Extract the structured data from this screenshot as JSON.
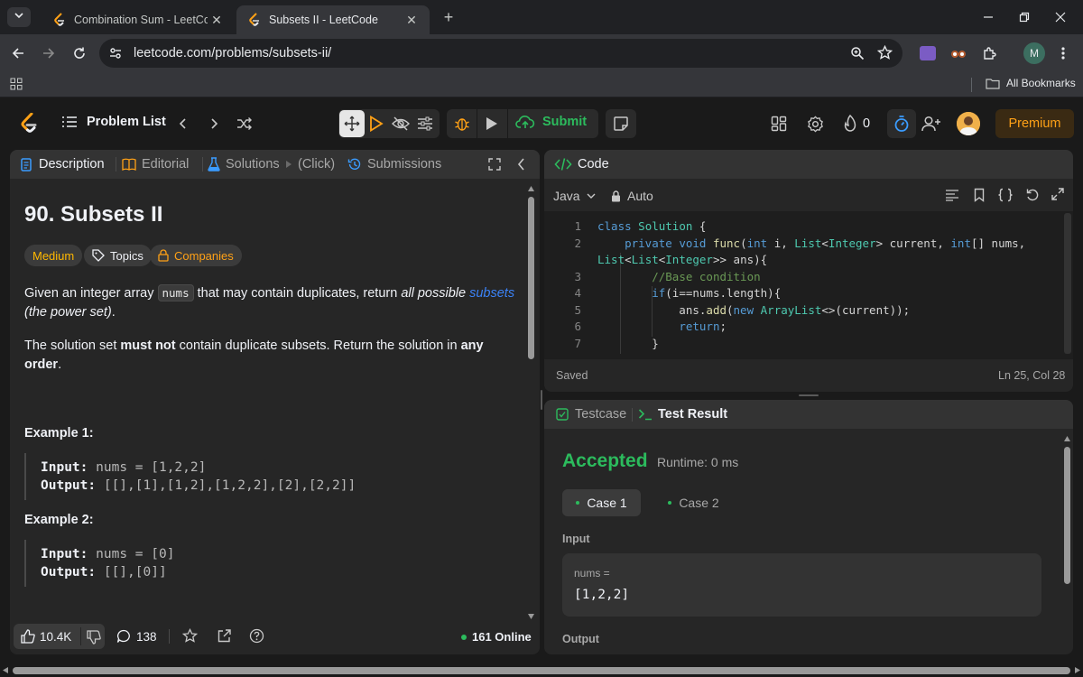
{
  "browser": {
    "tabs": [
      {
        "title": "Combination Sum - LeetCode",
        "active": false
      },
      {
        "title": "Subsets II - LeetCode",
        "active": true
      }
    ],
    "url": "leetcode.com/problems/subsets-ii/",
    "bookmarks_label": "All Bookmarks",
    "profile_initial": "M"
  },
  "toolbar": {
    "problem_list": "Problem List",
    "submit": "Submit",
    "streak": "0",
    "premium": "Premium"
  },
  "left_tabs": {
    "description": "Description",
    "editorial": "Editorial",
    "solutions": "Solutions",
    "click": "(Click)",
    "submissions": "Submissions"
  },
  "problem": {
    "title": "90. Subsets II",
    "difficulty": "Medium",
    "topics": "Topics",
    "companies": "Companies",
    "desc1_a": "Given an integer array ",
    "desc1_code": "nums",
    "desc1_b": " that may contain duplicates, return ",
    "desc1_italic": "all possible",
    "desc1_link": "subsets",
    "desc1_italic2": "(the power set)",
    "desc1_end": ".",
    "desc2_a": "The solution set ",
    "desc2_bold": "must not",
    "desc2_b": " contain duplicate subsets. Return the solution in ",
    "desc2_bold2": "any order",
    "desc2_end": ".",
    "examples": [
      {
        "heading": "Example 1:",
        "input_label": "Input:",
        "input": "nums = [1,2,2]",
        "output_label": "Output:",
        "output": "[[],[1],[1,2],[1,2,2],[2],[2,2]]"
      },
      {
        "heading": "Example 2:",
        "input_label": "Input:",
        "input": "nums = [0]",
        "output_label": "Output:",
        "output": "[[],[0]]"
      }
    ]
  },
  "footer": {
    "likes": "10.4K",
    "comments": "138",
    "online": "161 Online"
  },
  "code_panel": {
    "title": "Code",
    "language": "Java",
    "auto": "Auto",
    "status": "Saved",
    "position": "Ln 25, Col 28",
    "line_numbers": [
      "1",
      "2",
      "",
      "3",
      "4",
      "5",
      "6",
      "7"
    ]
  },
  "result_panel": {
    "testcase_tab": "Testcase",
    "result_tab": "Test Result",
    "verdict": "Accepted",
    "runtime": "Runtime: 0 ms",
    "case1": "Case 1",
    "case2": "Case 2",
    "input_label": "Input",
    "var_name": "nums =",
    "var_value": "[1,2,2]",
    "output_label": "Output"
  },
  "colors": {
    "accent_orange": "#ffa116",
    "accepted_green": "#2cbb5d",
    "link_blue": "#3b82f6",
    "medium_yellow": "#ffb800"
  }
}
